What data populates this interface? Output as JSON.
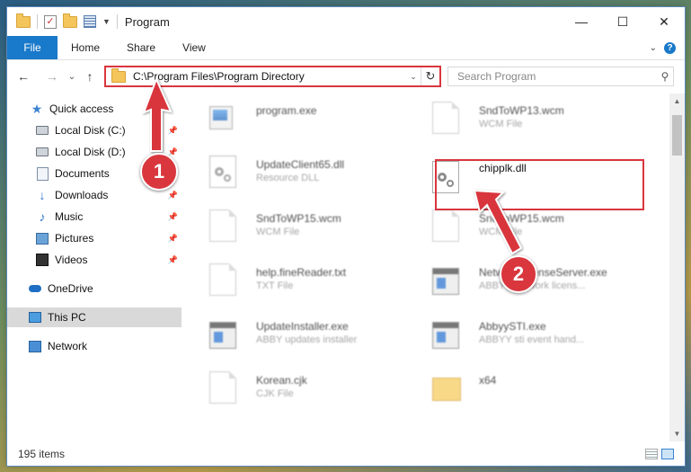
{
  "window": {
    "title": "Program",
    "controls": {
      "minimize": "—",
      "maximize": "☐",
      "close": "✕"
    }
  },
  "ribbon": {
    "tabs": [
      "File",
      "Home",
      "Share",
      "View"
    ],
    "collapse": "⌄",
    "help": "?"
  },
  "navigation": {
    "back": "←",
    "forward": "→",
    "recent": "⌄",
    "up": "↑",
    "address": "C:\\Program Files\\Program Directory",
    "refresh": "↻"
  },
  "search": {
    "placeholder": "Search Program",
    "icon": "search-icon"
  },
  "sidebar": {
    "items": [
      {
        "label": "Quick access",
        "icon": "star-icon",
        "pinned": false
      },
      {
        "label": "Local Disk (C:)",
        "icon": "disk-icon",
        "pinned": true
      },
      {
        "label": "Local Disk (D:)",
        "icon": "disk-icon",
        "pinned": true
      },
      {
        "label": "Documents",
        "icon": "documents-icon",
        "pinned": true
      },
      {
        "label": "Downloads",
        "icon": "downloads-icon",
        "pinned": true
      },
      {
        "label": "Music",
        "icon": "music-icon",
        "pinned": true
      },
      {
        "label": "Pictures",
        "icon": "pictures-icon",
        "pinned": true
      },
      {
        "label": "Videos",
        "icon": "videos-icon",
        "pinned": true
      },
      {
        "label": "OneDrive",
        "icon": "onedrive-icon",
        "pinned": false
      },
      {
        "label": "This PC",
        "icon": "this-pc-icon",
        "pinned": false,
        "selected": true
      },
      {
        "label": "Network",
        "icon": "network-icon",
        "pinned": false
      }
    ]
  },
  "files": [
    {
      "name": "program.exe",
      "type": "",
      "icon": "exe-icon"
    },
    {
      "name": "SndToWP13.wcm",
      "type": "WCM File",
      "icon": "document-icon"
    },
    {
      "name": "UpdateClient65.dll",
      "type": "Resource DLL",
      "icon": "dll-icon"
    },
    {
      "name": "chipplk.dll",
      "type": "",
      "icon": "dll-icon",
      "highlighted": true
    },
    {
      "name": "SndToWP15.wcm",
      "type": "WCM File",
      "icon": "document-icon"
    },
    {
      "name": "SndToWP15.wcm",
      "type": "WCM File",
      "icon": "document-icon"
    },
    {
      "name": "help.fineReader.txt",
      "type": "TXT File",
      "icon": "document-icon"
    },
    {
      "name": "NetworkLicenseServer.exe",
      "type": "ABBYY network licens...",
      "icon": "application-icon"
    },
    {
      "name": "UpdateInstaller.exe",
      "type": "ABBY updates installer",
      "icon": "application-icon"
    },
    {
      "name": "AbbyySTI.exe",
      "type": "ABBYY sti event hand...",
      "icon": "application-icon"
    },
    {
      "name": "Korean.cjk",
      "type": "CJK File",
      "icon": "document-icon"
    },
    {
      "name": "x64",
      "type": "",
      "icon": "folder-icon"
    }
  ],
  "status": {
    "item_count": "195 items"
  },
  "annotations": {
    "badge_1": "1",
    "badge_2": "2",
    "color": "#d9363e"
  },
  "colors": {
    "accent": "#1979ca",
    "highlight": "#d9363e",
    "selection": "#d9d9d9"
  }
}
